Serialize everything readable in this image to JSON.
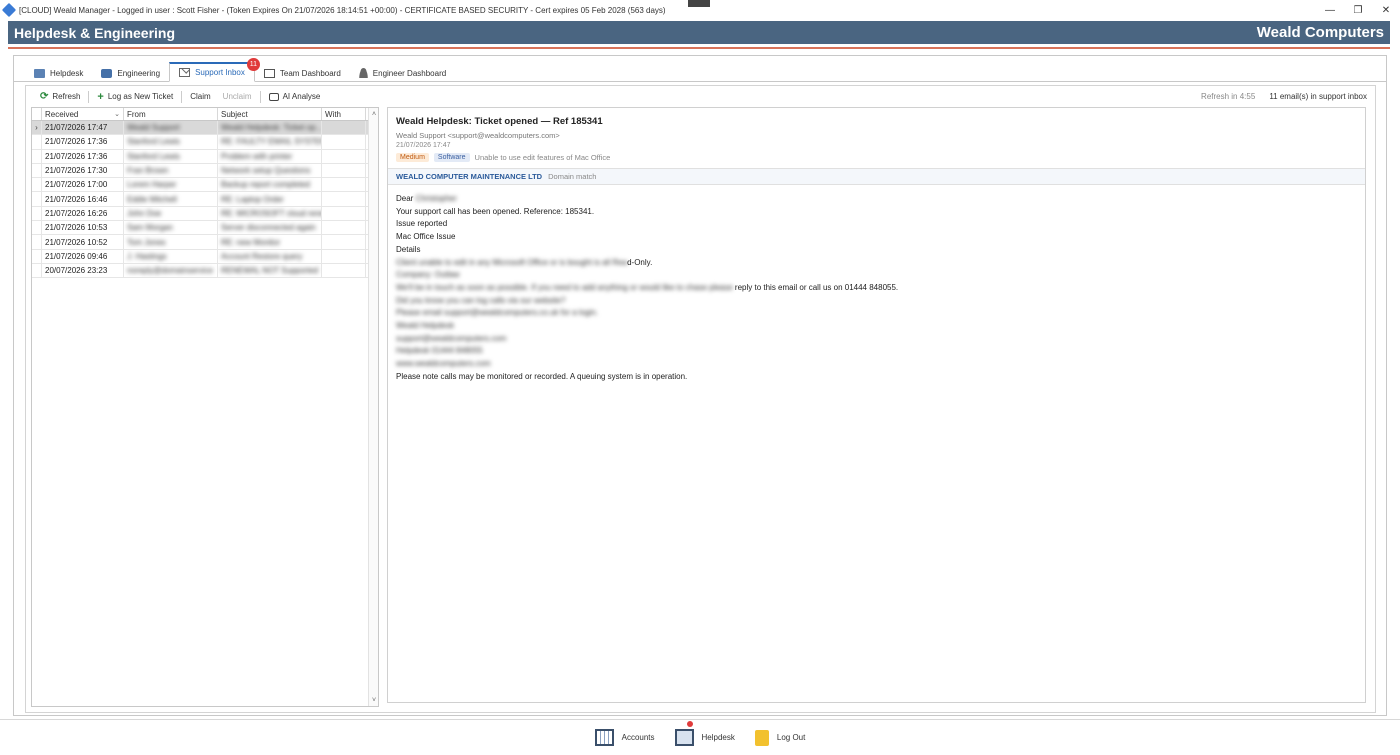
{
  "window": {
    "title": "[CLOUD]  Weald Manager - Logged in user : Scott Fisher - (Token Expires On 21/07/2026 18:14:51 +00:00) - CERTIFICATE BASED SECURITY - Cert expires 05 Feb 2028 (563 days)",
    "minimize": "—",
    "restore": "❐",
    "close": "✕"
  },
  "banner": {
    "left": "Helpdesk & Engineering",
    "right": "Weald Computers"
  },
  "tabs": [
    {
      "label": "Helpdesk",
      "icon": "helpdesk-icon"
    },
    {
      "label": "Engineering",
      "icon": "briefcase-icon"
    },
    {
      "label": "Support Inbox",
      "icon": "mail-icon",
      "badge": "11",
      "active": true
    },
    {
      "label": "Team Dashboard",
      "icon": "dashboard-icon"
    },
    {
      "label": "Engineer Dashboard",
      "icon": "user-icon"
    }
  ],
  "toolbar": {
    "refresh": "Refresh",
    "log_ticket": "Log as New Ticket",
    "claim": "Claim",
    "unclaim": "Unclaim",
    "ai_analyse": "AI Analyse",
    "refresh_in": "Refresh in 4:55",
    "inbox_count": "11 email(s) in support inbox"
  },
  "grid": {
    "columns": [
      "Received",
      "From",
      "Subject",
      "With"
    ],
    "rows": [
      {
        "received": "21/07/2026 17:47",
        "from": "Weald Support",
        "subject": "Weald Helpdesk: Ticket op...",
        "with": ""
      },
      {
        "received": "21/07/2026 17:36",
        "from": "Stanford Lewis",
        "subject": "RE: FAULTY EMAIL SYSTEM",
        "with": ""
      },
      {
        "received": "21/07/2026 17:36",
        "from": "Stanford Lewis",
        "subject": "Problem with printer",
        "with": ""
      },
      {
        "received": "21/07/2026 17:30",
        "from": "Fran Brown",
        "subject": "Network setup Questions",
        "with": ""
      },
      {
        "received": "21/07/2026 17:00",
        "from": "Lorem Harper",
        "subject": "Backup report completed",
        "with": ""
      },
      {
        "received": "21/07/2026 16:46",
        "from": "Eddie Mitchell",
        "subject": "RE: Laptop Order",
        "with": ""
      },
      {
        "received": "21/07/2026 16:26",
        "from": "John Doe",
        "subject": "RE: MICROSOFT cloud renew",
        "with": ""
      },
      {
        "received": "21/07/2026 10:53",
        "from": "Sam Morgan",
        "subject": "Server disconnected again",
        "with": ""
      },
      {
        "received": "21/07/2026 10:52",
        "from": "Tom Jones",
        "subject": "RE: new Monitor",
        "with": ""
      },
      {
        "received": "21/07/2026 09:46",
        "from": "J. Hastings",
        "subject": "Account Restore query",
        "with": ""
      },
      {
        "received": "20/07/2026 23:23",
        "from": "noreply@domainservice",
        "subject": "RENEWAL NOT Supported",
        "with": ""
      }
    ]
  },
  "reader": {
    "subject": "Weald Helpdesk: Ticket opened — Ref 185341",
    "from": "Weald Support <support@wealdcomputers.com>",
    "date": "21/07/2026 17:47",
    "priority": "Medium",
    "category": "Software",
    "summary": "Unable to use edit features of Mac Office",
    "match_company": "WEALD COMPUTER MAINTENANCE LTD",
    "match_type": "Domain match",
    "body": {
      "greeting_prefix": "Dear ",
      "greeting_name": "Christopher",
      "line1": "Your support call has been opened. Reference: 185341.",
      "line2": "Issue reported",
      "line3": "Mac Office Issue",
      "line4": "Details",
      "line5_blur": "Client unable to edit in any Microsoft Office or is bought is all Rea",
      "line5_clear": "d-Only.",
      "line6_blur": "Company: Outlaw",
      "line7_blur": "We'll be in touch as soon as possible. If you need to add anything or would like to chase please",
      "line7_clear": " reply to this email or call us on 01444 848055.",
      "line8_blur": "Did you know you can log calls via our website?",
      "line9_blur": "Please email support@wealdcomputers.co.uk for a login.",
      "line10_blur": "Weald Helpdesk",
      "line11_blur": "support@wealdcomputers.com",
      "line12_blur": "Helpdesk 01444 848055",
      "line13_blur": "www.wealdcomputers.com",
      "line14": "Please note calls may be monitored or recorded. A queuing system is in operation."
    }
  },
  "footer": {
    "accounts": "Accounts",
    "helpdesk": "Helpdesk",
    "logout": "Log Out"
  }
}
